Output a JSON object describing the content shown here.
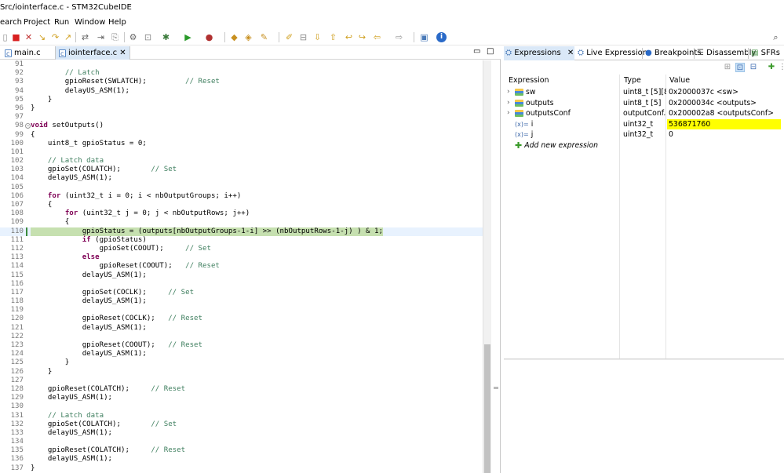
{
  "window": {
    "title": "Src/iointerface.c - STM32CubeIDE"
  },
  "menu": [
    "earch",
    "Project",
    "Run",
    "Window",
    "Help"
  ],
  "toolbar_icons": [
    "toggle-icon",
    "stop-icon",
    "disconnect-icon",
    "step-into-icon",
    "step-over-icon",
    "step-return-icon",
    "instruction-step-icon",
    "drop-frame-icon",
    "debug-config-icon",
    "run-icon",
    "external-tools-icon",
    "new-c-project-icon",
    "open-type-icon",
    "build-icon",
    "annotation-icon",
    "next-annotation-icon",
    "prev-annotation-icon",
    "back-icon",
    "forward-icon",
    "perspective-icon",
    "info-icon",
    "search-icon"
  ],
  "editor": {
    "tabs": [
      {
        "label": "main.c"
      },
      {
        "label": "iointerface.c",
        "active": true
      }
    ],
    "lines": [
      {
        "n": 91,
        "t": ""
      },
      {
        "n": 92,
        "t": "        // Latch"
      },
      {
        "n": 93,
        "t": "        gpioReset(SWLATCH);         // Reset"
      },
      {
        "n": 94,
        "t": "        delayUS_ASM(1);"
      },
      {
        "n": 95,
        "t": "    }"
      },
      {
        "n": 96,
        "t": "}"
      },
      {
        "n": 97,
        "t": ""
      },
      {
        "n": 98,
        "t": "void setOutputs()"
      },
      {
        "n": 99,
        "t": "{"
      },
      {
        "n": 100,
        "t": "    uint8_t gpioStatus = 0;"
      },
      {
        "n": 101,
        "t": ""
      },
      {
        "n": 102,
        "t": "    // Latch data"
      },
      {
        "n": 103,
        "t": "    gpioSet(COLATCH);       // Set"
      },
      {
        "n": 104,
        "t": "    delayUS_ASM(1);"
      },
      {
        "n": 105,
        "t": ""
      },
      {
        "n": 106,
        "t": "    for (uint32_t i = 0; i < nbOutputGroups; i++)"
      },
      {
        "n": 107,
        "t": "    {"
      },
      {
        "n": 108,
        "t": "        for (uint32_t j = 0; j < nbOutputRows; j++)"
      },
      {
        "n": 109,
        "t": "        {"
      },
      {
        "n": 110,
        "t": "            gpioStatus = (outputs[nbOutputGroups-1-i] >> (nbOutputRows-1-j) ) & 1;"
      },
      {
        "n": 111,
        "t": "            if (gpioStatus)"
      },
      {
        "n": 112,
        "t": "                gpioSet(COOUT);     // Set"
      },
      {
        "n": 113,
        "t": "            else"
      },
      {
        "n": 114,
        "t": "                gpioReset(COOUT);   // Reset"
      },
      {
        "n": 115,
        "t": "            delayUS_ASM(1);"
      },
      {
        "n": 116,
        "t": ""
      },
      {
        "n": 117,
        "t": "            gpioSet(COCLK);     // Set"
      },
      {
        "n": 118,
        "t": "            delayUS_ASM(1);"
      },
      {
        "n": 119,
        "t": ""
      },
      {
        "n": 120,
        "t": "            gpioReset(COCLK);   // Reset"
      },
      {
        "n": 121,
        "t": "            delayUS_ASM(1);"
      },
      {
        "n": 122,
        "t": ""
      },
      {
        "n": 123,
        "t": "            gpioReset(COOUT);   // Reset"
      },
      {
        "n": 124,
        "t": "            delayUS_ASM(1);"
      },
      {
        "n": 125,
        "t": "        }"
      },
      {
        "n": 126,
        "t": "    }"
      },
      {
        "n": 127,
        "t": ""
      },
      {
        "n": 128,
        "t": "    gpioReset(COLATCH);     // Reset"
      },
      {
        "n": 129,
        "t": "    delayUS_ASM(1);"
      },
      {
        "n": 130,
        "t": ""
      },
      {
        "n": 131,
        "t": "    // Latch data"
      },
      {
        "n": 132,
        "t": "    gpioSet(COLATCH);       // Set"
      },
      {
        "n": 133,
        "t": "    delayUS_ASM(1);"
      },
      {
        "n": 134,
        "t": ""
      },
      {
        "n": 135,
        "t": "    gpioReset(COLATCH);     // Reset"
      },
      {
        "n": 136,
        "t": "    delayUS_ASM(1);"
      },
      {
        "n": 137,
        "t": "}"
      }
    ],
    "current_line": 110
  },
  "views": {
    "tabs": [
      "Expressions",
      "Live Expressions",
      "Breakpoints",
      "Disassembly",
      "SFRs"
    ],
    "active_tab": "Expressions"
  },
  "expressions": {
    "columns": [
      "Expression",
      "Type",
      "Value"
    ],
    "rows": [
      {
        "name": "sw",
        "type": "uint8_t [5][8]",
        "value": "0x2000037c <sw>",
        "icon": "struct-icon",
        "expandable": true
      },
      {
        "name": "outputs",
        "type": "uint8_t [5]",
        "value": "0x2000034c <outputs>",
        "icon": "struct-icon",
        "expandable": true
      },
      {
        "name": "outputsConf",
        "type": "outputConf...",
        "value": "0x200002a8 <outputsConf>",
        "icon": "struct-icon",
        "expandable": true
      },
      {
        "name": "i",
        "type": "uint32_t",
        "value": "536871760",
        "icon": "variable-icon",
        "expandable": false,
        "highlight": true
      },
      {
        "name": "j",
        "type": "uint32_t",
        "value": "0",
        "icon": "variable-icon",
        "expandable": false
      }
    ],
    "add_label": "Add new expression",
    "highlight_color": "#ffff00"
  }
}
